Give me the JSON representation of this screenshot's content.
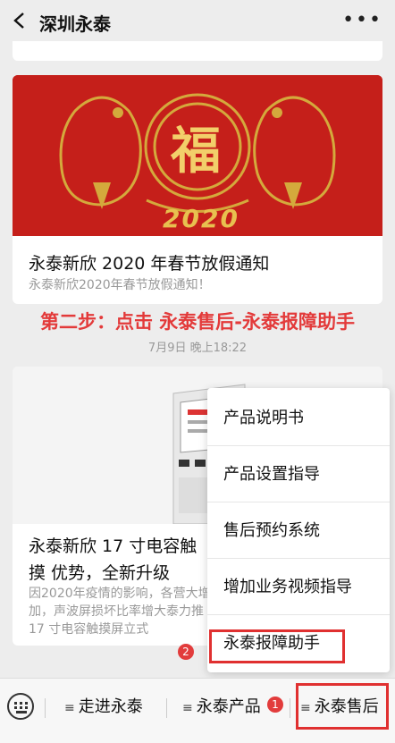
{
  "header": {
    "title": "深圳永泰"
  },
  "article1": {
    "banner_year": "2020",
    "banner_char": "福",
    "title": "永泰新欣 2020 年春节放假通知",
    "subtitle": "永泰新欣2020年春节放假通知！"
  },
  "annotation": "第二步：点击 永泰售后-永泰报障助手",
  "timestamp": "7月9日 晚上18:22",
  "article2": {
    "title": "永泰新欣 17 寸电容触摸 优势，全新升级",
    "desc": "因2020年疫情的影响，各营大增加，声波屏损坏比率增大泰力推17 寸电容触摸屏立式"
  },
  "menu": {
    "items": [
      "产品说明书",
      "产品设置指导",
      "售后预约系统",
      "增加业务视频指导",
      "永泰报障助手"
    ]
  },
  "badges": {
    "menu_badge": "2",
    "tab_badge": "1"
  },
  "bottom_tabs": [
    "走进永泰",
    "永泰产品",
    "永泰售后"
  ],
  "colors": {
    "accent_red": "#e03030",
    "banner_red": "#c51f1a",
    "gold": "#d4a93c"
  }
}
